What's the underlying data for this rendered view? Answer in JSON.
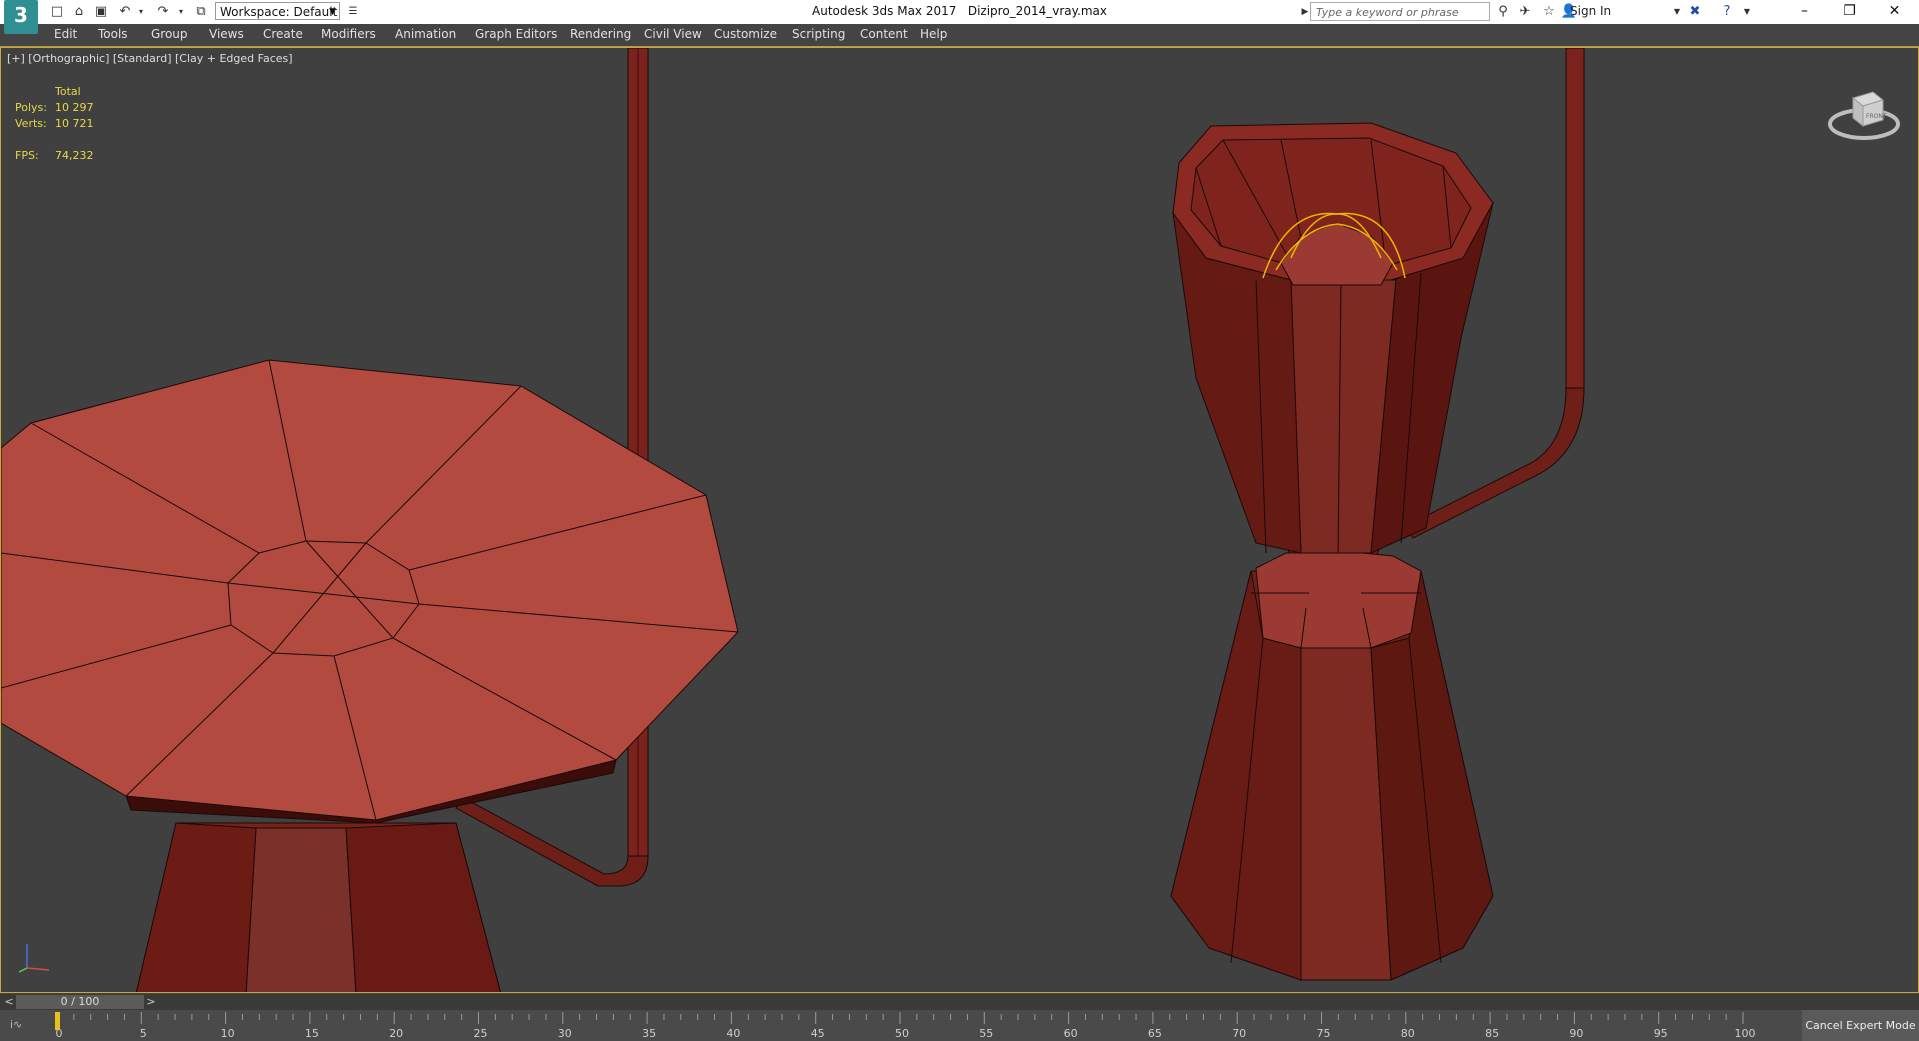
{
  "titlebar": {
    "logo_text": "3",
    "workspace_label": "Workspace: Default",
    "app_title": "Autodesk 3ds Max 2017",
    "file_name": "Dizipro_2014_vray.max",
    "search_placeholder": "Type a keyword or phrase",
    "signin_label": "Sign In"
  },
  "menubar": {
    "items": [
      "Edit",
      "Tools",
      "Group",
      "Views",
      "Create",
      "Modifiers",
      "Animation",
      "Graph Editors",
      "Rendering",
      "Civil View",
      "Customize",
      "Scripting",
      "Content",
      "Help"
    ]
  },
  "viewport": {
    "label": "[+] [Orthographic] [Standard] [Clay + Edged Faces]",
    "stats": {
      "header": "Total",
      "polys_label": "Polys:",
      "polys_value": "10 297",
      "verts_label": "Verts:",
      "verts_value": "10 721",
      "fps_label": "FPS:",
      "fps_value": "74,232"
    },
    "viewcube_label": "FRONT",
    "colors": {
      "background": "#404040",
      "model": "#b5483e",
      "wire": "#1a0a08",
      "selection": "#f0b400",
      "border": "#c8a93c"
    }
  },
  "timeslider": {
    "prev_label": "<",
    "position_label": "0 / 100",
    "next_label": ">"
  },
  "trackbar": {
    "icon": "curve-icon",
    "ticks": [
      "0",
      "5",
      "10",
      "15",
      "20",
      "25",
      "30",
      "35",
      "40",
      "45",
      "50",
      "55",
      "60",
      "65",
      "70",
      "75",
      "80",
      "85",
      "90",
      "95",
      "100"
    ],
    "current_frame": 0,
    "cancel_expert_label": "Cancel Expert Mode"
  }
}
